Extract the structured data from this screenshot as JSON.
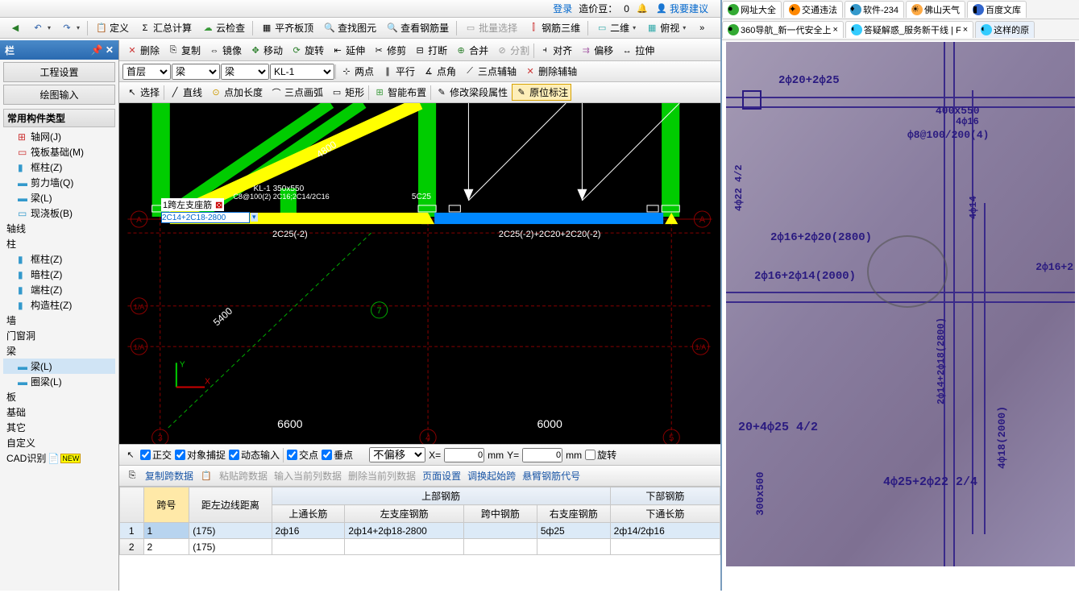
{
  "header": {
    "login": "登录",
    "beans_label": "造价豆：",
    "beans_value": "0",
    "suggest": "我要建议"
  },
  "toolbar1": {
    "define": "定义",
    "sumcalc": "汇总计算",
    "cloudcheck": "云检查",
    "flatslab": "平齐板顶",
    "findelem": "查找图元",
    "viewrebar": "查看钢筋量",
    "batchsel": "批量选择",
    "rebar3d": "钢筋三维",
    "twod": "二维",
    "aerial": "俯视"
  },
  "toolbar2": {
    "select": "选择",
    "line": "直线",
    "ptlen": "点加长度",
    "arc3pt": "三点画弧",
    "rect": "矩形",
    "smartlay": "智能布置",
    "editbeamattr": "修改梁段属性",
    "origmark": "原位标注"
  },
  "toolbar_edit": {
    "delete": "删除",
    "copy": "复制",
    "mirror": "镜像",
    "move": "移动",
    "rotate": "旋转",
    "extend": "延伸",
    "trim": "修剪",
    "break": "打断",
    "merge": "合并",
    "split": "分割",
    "align": "对齐",
    "offset": "偏移",
    "stretch": "拉伸"
  },
  "toolbar_axis": {
    "floors": "首层",
    "cat": "梁",
    "sub": "梁",
    "member": "KL-1",
    "twopt": "两点",
    "parallel": "平行",
    "ptangle": "点角",
    "threeaux": "三点辅轴",
    "delaux": "删除辅轴"
  },
  "left": {
    "title": "栏",
    "sec1": "工程设置",
    "sec2": "绘图输入",
    "treehead": "常用构件类型",
    "nodes": {
      "axis": "轴网(J)",
      "raft": "筏板基础(M)",
      "framecol": "框柱(Z)",
      "shearwall": "剪力墙(Q)",
      "beam1": "梁(L)",
      "castslab": "现浇板(B)",
      "axline": "轴线",
      "col": "柱",
      "framecol2": "框柱(Z)",
      "darkcol": "暗柱(Z)",
      "endcol": "端柱(Z)",
      "conscol": "构造柱(Z)",
      "wall": "墙",
      "opening": "门窗洞",
      "beamcat": "梁",
      "beam2": "梁(L)",
      "ringbeam": "圈梁(L)",
      "slab": "板",
      "found": "基础",
      "other": "其它",
      "custom": "自定义",
      "cad": "CAD识别"
    }
  },
  "canvas": {
    "input_label": "1跨左支座筋",
    "input_value": "2C14+2C18-2800",
    "text1": "KL-1 350x550",
    "text1b": "C8@100(2) 2C16;2C14/2C16",
    "text2": "5C25",
    "dim48": "4800",
    "dim54": "5400",
    "dim66": "6600",
    "dim60": "6000",
    "lbl_a": "A",
    "lbl_a2": "A",
    "lbl_1a": "1/A",
    "lbl_1a2": "1/A",
    "lbl_3": "3",
    "lbl_4": "4",
    "lbl_5": "5",
    "lbl_7": "7",
    "anno1": "2C25(-2)",
    "anno2": "2C25(-2)+2C20+2C20(-2)"
  },
  "status": {
    "ortho": "正交",
    "snap": "对象捕捉",
    "dyn": "动态输入",
    "cross": "交点",
    "perp": "垂点",
    "nooffset": "不偏移",
    "xlabel": "X=",
    "xval": "0",
    "ylabel": "Y=",
    "yval": "0",
    "mm": "mm",
    "rotlbl": "旋转"
  },
  "tablebar": {
    "copyspan": "复制跨数据",
    "pastespan": "粘贴跨数据",
    "inputcol": "输入当前列数据",
    "delcol": "删除当前列数据",
    "pageset": "页面设置",
    "swapends": "调换起始跨",
    "cantcode": "悬臂钢筋代号"
  },
  "table": {
    "h_span": "跨号",
    "h_dist": "距左边线距离",
    "h_upper": "上部钢筋",
    "h_lower": "下部钢筋",
    "h_topthrough": "上通长筋",
    "h_leftsup": "左支座钢筋",
    "h_midspan": "跨中钢筋",
    "h_rightsup": "右支座钢筋",
    "h_botthrough": "下通长筋",
    "rows": [
      {
        "n": "1",
        "span": "1",
        "dist": "(175)",
        "top": "2ф16",
        "left": "2ф14+2ф18-2800",
        "mid": "",
        "right": "5ф25",
        "bot": "2ф14/2ф16"
      },
      {
        "n": "2",
        "span": "2",
        "dist": "(175)",
        "top": "",
        "left": "",
        "mid": "",
        "right": "",
        "bot": ""
      }
    ]
  },
  "right": {
    "toptabs": {
      "t1": "网址大全",
      "t2": "交通违法",
      "t3": "软件-234",
      "t4": "佛山天气",
      "t5": "百度文库"
    },
    "tabs": {
      "t1": "360导航_新一代安全上",
      "t2": "答疑解惑_服务新干线 | F",
      "t3": "这样的原"
    },
    "bp": {
      "a": "2ф20+2ф25",
      "b": "400x550",
      "b2": "4ф16",
      "c": "ф8@100/200(4)",
      "d": "2ф16+2ф20(2800)",
      "e": "2ф16+2ф14(2000)",
      "f": "2ф16+2",
      "g": "20+4ф25 4/2",
      "h": "4ф25+2ф22 2/4",
      "i": "300x500",
      "j": "4ф18(2000)",
      "k": "2ф14+2ф18(2800)",
      "v1": "4ф22 4/2",
      "v2": "4ф14"
    }
  }
}
